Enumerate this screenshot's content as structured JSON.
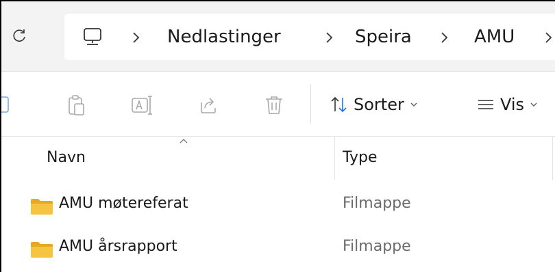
{
  "address_bar": {
    "crumbs": [
      "Nedlastinger",
      "Speira",
      "AMU"
    ],
    "separator": ">"
  },
  "toolbar": {
    "sort_label": "Sorter",
    "view_label": "Vis"
  },
  "columns": {
    "name": "Navn",
    "type": "Type"
  },
  "rows": [
    {
      "name": "AMU møtereferat",
      "type": "Filmappe"
    },
    {
      "name": "AMU årsrapport",
      "type": "Filmappe"
    }
  ],
  "colors": {
    "folder": "#f5c542",
    "sort_icon_accent": "#1a73e8",
    "disabled_icon": "#a8a8a8"
  },
  "icons": [
    "refresh-icon",
    "this-pc-icon",
    "copy-icon",
    "paste-icon",
    "rename-icon",
    "share-icon",
    "delete-icon",
    "sort-icon",
    "view-icon",
    "folder-icon"
  ]
}
